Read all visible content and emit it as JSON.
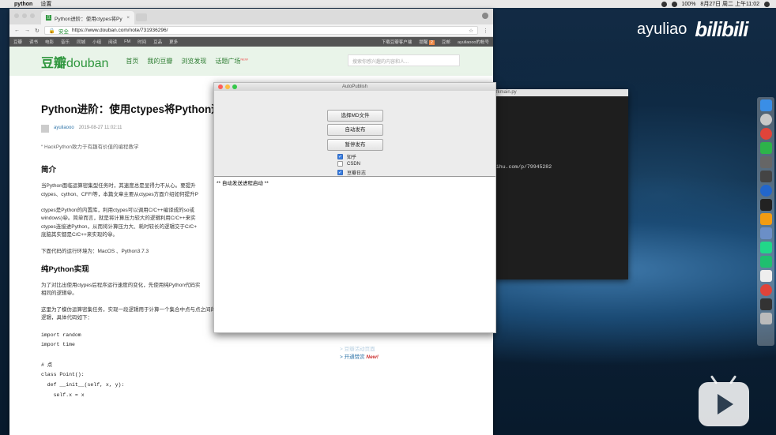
{
  "menubar": {
    "app_name": "python",
    "menu_settings": "设置",
    "battery": "100%",
    "datetime": "8月27日 周二 上午11:02"
  },
  "browser": {
    "tab_title": "Python进阶：使用ctypes将Py",
    "secure_label": "安全",
    "url": "https://www.douban.com/note/731936296/",
    "nav_left": [
      "豆瓣",
      "读书",
      "电影",
      "音乐",
      "同城",
      "小组",
      "阅读",
      "FM",
      "时间",
      "豆品",
      "更多"
    ],
    "nav_right": [
      "下载豆瓣客户端",
      "提醒",
      "豆邮",
      "ayuliaooo的帐号"
    ],
    "notification_count": "2"
  },
  "douban": {
    "logo_cn": "豆瓣",
    "logo_en": "douban",
    "nav": [
      "首页",
      "我的豆瓣",
      "浏览发现",
      "话题广场"
    ],
    "nav_badge": "NEW",
    "search_placeholder": "搜索你感兴趣的内容和人..."
  },
  "article": {
    "title": "Python进阶：使用ctypes将Python运",
    "author": "ayuliaooo",
    "date": "2019-08-27 11:02:11",
    "quote": "HackPython致力于有趣有价值的编程教学",
    "h_intro": "简介",
    "p1": "当Python面临运算密集型任务时，其速度总是显得力不从心。要提升",
    "p1b": "ctypes、cython、CFFI等，本篇文章主要从ctypes方面介绍如何提升P",
    "p2": "ctypes是Python的内置库，利用ctypes可以调用C/C++编译成的so或",
    "p2b": "windows)😀。简单而言，就是将计算压力较大的逻辑利用C/C++来实",
    "p2c": "ctypes连接进Python，从而将计算压力大、耗时较长的逻辑交于C/C+",
    "p2d": "底脑其实都是C/C++来实现的😀。",
    "p3": "下面代码的运行环境为：MacOS 、Python3.7.3",
    "h_pure": "纯Python实现",
    "p4": "为了对比出使用ctypes后程序运行速度的变化，先使用纯Python代码实",
    "p4b": "相同的逻辑😀。",
    "p5": "这里为了模仿运算密集任务，实现一段逻辑用于计算一个集合中点与点之间的距离以及实现一个操作字符串的",
    "p5b": "逻辑，具体代码如下：",
    "code": [
      "import random",
      "import time",
      "",
      "# 点",
      "class Point():",
      "  def __init__(self, x, y):",
      "    self.x = x"
    ]
  },
  "sidebar": {
    "link1": "> 豆瓣活动页面",
    "link2": "> 开通赞赏",
    "new_tag": "New!"
  },
  "terminal": {
    "title": "fkmain.py",
    "line": "hihu.com/p/79945282"
  },
  "autopublish": {
    "title": "AutoPublish",
    "buttons": [
      "选择MD文件",
      "自动发布",
      "暂停发布"
    ],
    "checkboxes": [
      {
        "label": "知乎",
        "checked": true
      },
      {
        "label": "CSDN",
        "checked": false
      },
      {
        "label": "豆瓣日志",
        "checked": true
      }
    ],
    "log": "** 自动发送进程启动 **"
  },
  "watermark": {
    "user": "ayuliao",
    "brand": "bilibili"
  }
}
